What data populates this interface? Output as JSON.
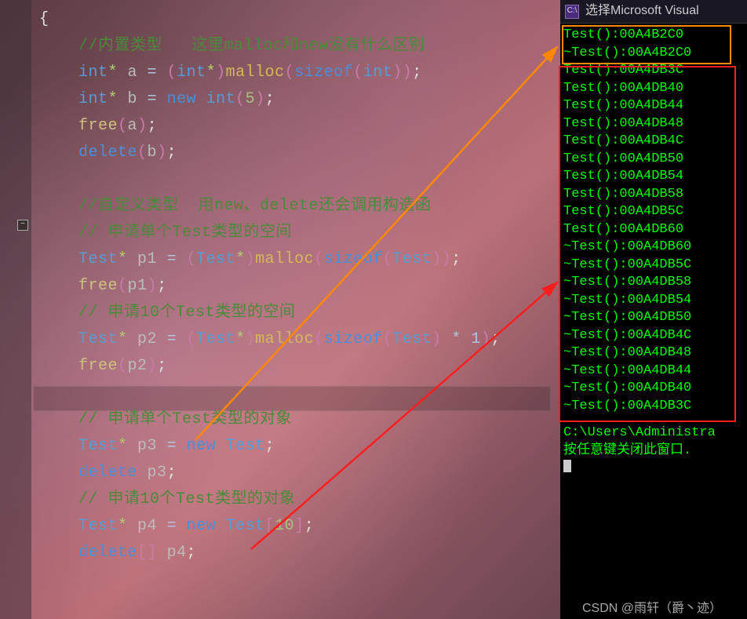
{
  "editor": {
    "fold_glyph": "−",
    "lines": [
      {
        "t": "brace",
        "text": "{"
      },
      {
        "t": "comment",
        "indent": 1,
        "text": "//内置类型   这里malloc和new没有什么区别"
      },
      {
        "t": "stmt_malloc_int",
        "indent": 1,
        "type_kw": "int",
        "ptr": "*",
        "var": "a",
        "op": "=",
        "cast_open": "(",
        "cast_type": "int",
        "cast_ptr": "*",
        "cast_close": ")",
        "func": "malloc",
        "args_open": "(",
        "sizeof": "sizeof",
        "so_open": "(",
        "so_arg": "int",
        "so_close": ")",
        "args_close": ")",
        "term": ";"
      },
      {
        "t": "stmt_new_int",
        "indent": 1,
        "type_kw": "int",
        "ptr": "*",
        "var": "b",
        "op": "=",
        "new": "new",
        "ntype": "int",
        "paren_open": "(",
        "num": "5",
        "paren_close": ")",
        "term": ";"
      },
      {
        "t": "call",
        "indent": 1,
        "func": "free",
        "paren_open": "(",
        "arg": "a",
        "paren_close": ")",
        "term": ";"
      },
      {
        "t": "delete",
        "indent": 1,
        "kw": "delete",
        "paren_open": "(",
        "arg": "b",
        "paren_close": ")",
        "term": ";"
      },
      {
        "t": "blank"
      },
      {
        "t": "comment",
        "indent": 1,
        "text": "//自定义类型  用new、delete还会调用构造函"
      },
      {
        "t": "comment",
        "indent": 1,
        "text": "// 申请单个Test类型的空间"
      },
      {
        "t": "stmt_malloc_test",
        "indent": 1,
        "type_kw": "Test",
        "ptr": "*",
        "var": "p1",
        "op": "=",
        "cast_open": "(",
        "cast_type": "Test",
        "cast_ptr": "*",
        "cast_close": ")",
        "func": "malloc",
        "args_open": "(",
        "sizeof": "sizeof",
        "so_open": "(",
        "so_arg": "Test",
        "so_close": ")",
        "args_close": ")",
        "term": ";"
      },
      {
        "t": "call",
        "indent": 1,
        "func": "free",
        "paren_open": "(",
        "arg": "p1",
        "paren_close": ")",
        "term": ";"
      },
      {
        "t": "comment",
        "indent": 1,
        "text": "// 申请10个Test类型的空间"
      },
      {
        "t": "stmt_malloc_test10",
        "indent": 1,
        "type_kw": "Test",
        "ptr": "*",
        "var": "p2",
        "op": "=",
        "cast_open": "(",
        "cast_type": "Test",
        "cast_ptr": "*",
        "cast_close": ")",
        "func": "malloc",
        "args_open": "(",
        "sizeof": "sizeof",
        "so_open": "(",
        "so_arg": "Test",
        "so_close": ")",
        "mul": " * 1",
        "args_close": ")",
        "term": ";"
      },
      {
        "t": "call",
        "indent": 1,
        "func": "free",
        "paren_open": "(",
        "arg": "p2",
        "paren_close": ")",
        "term": ";"
      },
      {
        "t": "blank"
      },
      {
        "t": "comment",
        "indent": 1,
        "text": "// 申请单个Test类型的对象"
      },
      {
        "t": "stmt_new_test",
        "indent": 1,
        "type_kw": "Test",
        "ptr": "*",
        "var": "p3",
        "op": "=",
        "new": "new",
        "ntype": "Test",
        "term": ";"
      },
      {
        "t": "delete_plain",
        "indent": 1,
        "kw": "delete",
        "arg": "p3",
        "term": ";"
      },
      {
        "t": "comment",
        "indent": 1,
        "text": "// 申请10个Test类型的对象"
      },
      {
        "t": "stmt_new_arr",
        "indent": 1,
        "type_kw": "Test",
        "ptr": "*",
        "var": "p4",
        "op": "=",
        "new": "new",
        "ntype": "Test",
        "br_open": "[",
        "num": "10",
        "br_close": "]",
        "term": ";"
      },
      {
        "t": "delete_arr",
        "indent": 1,
        "kw": "delete",
        "br": "[]",
        "arg": "p4",
        "term": ";"
      }
    ]
  },
  "console": {
    "title_prefix": "选择",
    "title_app": "Microsoft Visual",
    "icon_label": "C:\\",
    "lines": [
      "Test():00A4B2C0",
      "~Test():00A4B2C0",
      "Test():00A4DB3C",
      "Test():00A4DB40",
      "Test():00A4DB44",
      "Test():00A4DB48",
      "Test():00A4DB4C",
      "Test():00A4DB50",
      "Test():00A4DB54",
      "Test():00A4DB58",
      "Test():00A4DB5C",
      "Test():00A4DB60",
      "~Test():00A4DB60",
      "~Test():00A4DB5C",
      "~Test():00A4DB58",
      "~Test():00A4DB54",
      "~Test():00A4DB50",
      "~Test():00A4DB4C",
      "~Test():00A4DB48",
      "~Test():00A4DB44",
      "~Test():00A4DB40",
      "~Test():00A4DB3C"
    ],
    "prompt_path": "C:\\Users\\Administra",
    "prompt_hint": "按任意键关闭此窗口."
  },
  "watermark": "CSDN @雨轩（爵丶迹）"
}
